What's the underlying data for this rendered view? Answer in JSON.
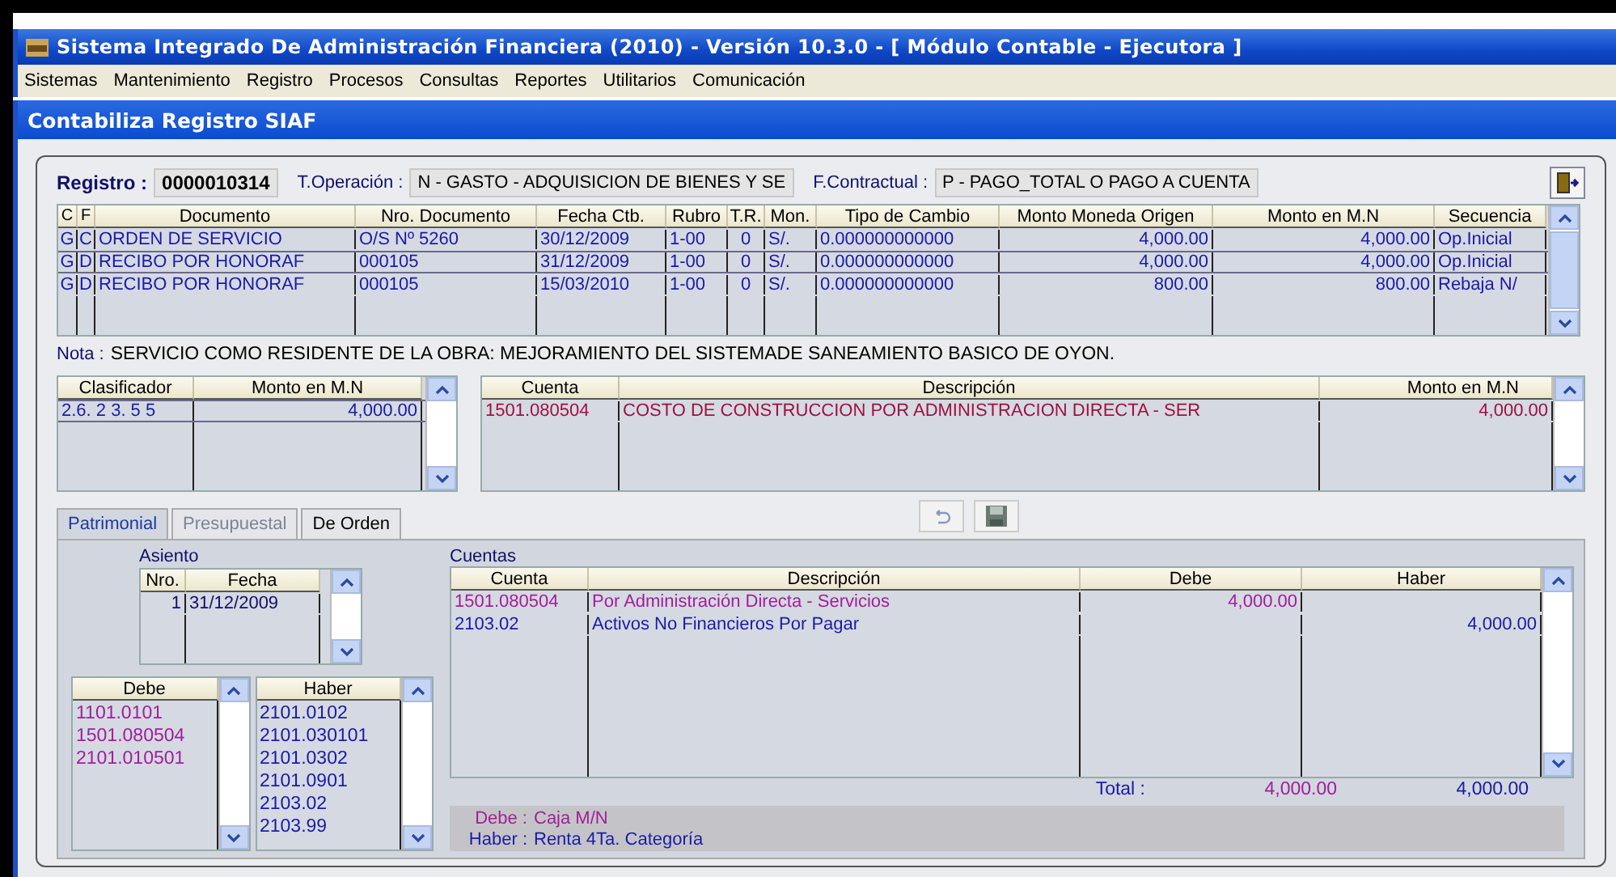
{
  "window": {
    "title": "Sistema Integrado De Administración Financiera (2010) - Versión 10.3.0 - [ Módulo Contable - Ejecutora ]"
  },
  "menu": [
    "Sistemas",
    "Mantenimiento",
    "Registro",
    "Procesos",
    "Consultas",
    "Reportes",
    "Utilitarios",
    "Comunicación"
  ],
  "form": {
    "title": "Contabiliza Registro SIAF"
  },
  "registro": {
    "label": "Registro :",
    "value": "0000010314"
  },
  "operacion": {
    "label": "T.Operación :",
    "value": "N  - GASTO - ADQUISICION DE BIENES Y SE"
  },
  "contractual": {
    "label": "F.Contractual :",
    "value": "P - PAGO_TOTAL O PAGO A CUENTA"
  },
  "documents": {
    "columns": [
      "C",
      "F",
      "Documento",
      "Nro. Documento",
      "Fecha Ctb.",
      "Rubro",
      "T.R.",
      "Mon.",
      "Tipo de Cambio",
      "Monto Moneda Origen",
      "Monto en M.N",
      "Secuencia"
    ],
    "rows": [
      {
        "selected": false,
        "cells": [
          "G",
          "C",
          "ORDEN DE SERVICIO",
          "O/S Nº 5260",
          "30/12/2009",
          "1-00",
          "0",
          "S/.",
          "0.000000000000",
          "4,000.00",
          "4,000.00",
          "Op.Inicial"
        ]
      },
      {
        "selected": true,
        "cells": [
          "G",
          "D",
          "RECIBO POR HONORAF",
          "000105",
          "31/12/2009",
          "1-00",
          "0",
          "S/.",
          "0.000000000000",
          "4,000.00",
          "4,000.00",
          "Op.Inicial"
        ]
      },
      {
        "selected": false,
        "cells": [
          "G",
          "D",
          "RECIBO POR HONORAF",
          "000105",
          "15/03/2010",
          "1-00",
          "0",
          "S/.",
          "0.000000000000",
          "800.00",
          "800.00",
          "Rebaja N/"
        ]
      }
    ]
  },
  "nota": {
    "label": "Nota :",
    "value": "SERVICIO COMO RESIDENTE DE LA OBRA: MEJORAMIENTO DEL SISTEMADE SANEAMIENTO BASICO DE OYON."
  },
  "clasificadores": {
    "columns": [
      "Clasificador",
      "Monto en M.N"
    ],
    "rows": [
      {
        "selected": true,
        "cells": [
          "2.6. 2 3. 5 5",
          "4,000.00"
        ]
      }
    ]
  },
  "presupuesto": {
    "columns": [
      "Cuenta",
      "Descripción",
      "Monto en M.N"
    ],
    "rows": [
      {
        "cells": [
          "1501.080504",
          "COSTO DE CONSTRUCCION POR ADMINISTRACION DIRECTA - SER",
          "4,000.00"
        ]
      }
    ]
  },
  "tabs": [
    {
      "label": "Patrimonial",
      "selected": true,
      "disabled": false
    },
    {
      "label": "Presupuestal",
      "selected": false,
      "disabled": true
    },
    {
      "label": "De Orden",
      "selected": false,
      "disabled": false
    }
  ],
  "asiento": {
    "title": "Asiento",
    "columns": [
      "Nro.",
      "Fecha"
    ],
    "rows": [
      {
        "cells": [
          "1",
          "31/12/2009"
        ]
      }
    ]
  },
  "debe_list": {
    "title": "Debe",
    "items": [
      "1101.0101",
      "1501.080504",
      "2101.010501"
    ]
  },
  "haber_list": {
    "title": "Haber",
    "items": [
      "2101.0102",
      "2101.030101",
      "2101.0302",
      "2101.0901",
      "2103.02",
      "2103.99"
    ]
  },
  "cuentas": {
    "title": "Cuentas",
    "columns": [
      "Cuenta",
      "Descripción",
      "Debe",
      "Haber"
    ],
    "rows": [
      {
        "kind": "debe",
        "cuenta": "1501.080504",
        "descripcion": "Por Administración Directa - Servicios",
        "debe": "4,000.00"
      },
      {
        "kind": "haber",
        "cuenta": "2103.02",
        "descripcion": "Activos No Financieros Por Pagar",
        "haber": "4,000.00"
      }
    ]
  },
  "total": {
    "label": "Total :",
    "debe": "4,000.00",
    "haber": "4,000.00"
  },
  "footer": [
    {
      "kind": "debe",
      "label": "Debe :",
      "value": "Caja M/N"
    },
    {
      "kind": "haber",
      "label": "Haber :",
      "value": "Renta 4Ta. Categoría"
    }
  ]
}
